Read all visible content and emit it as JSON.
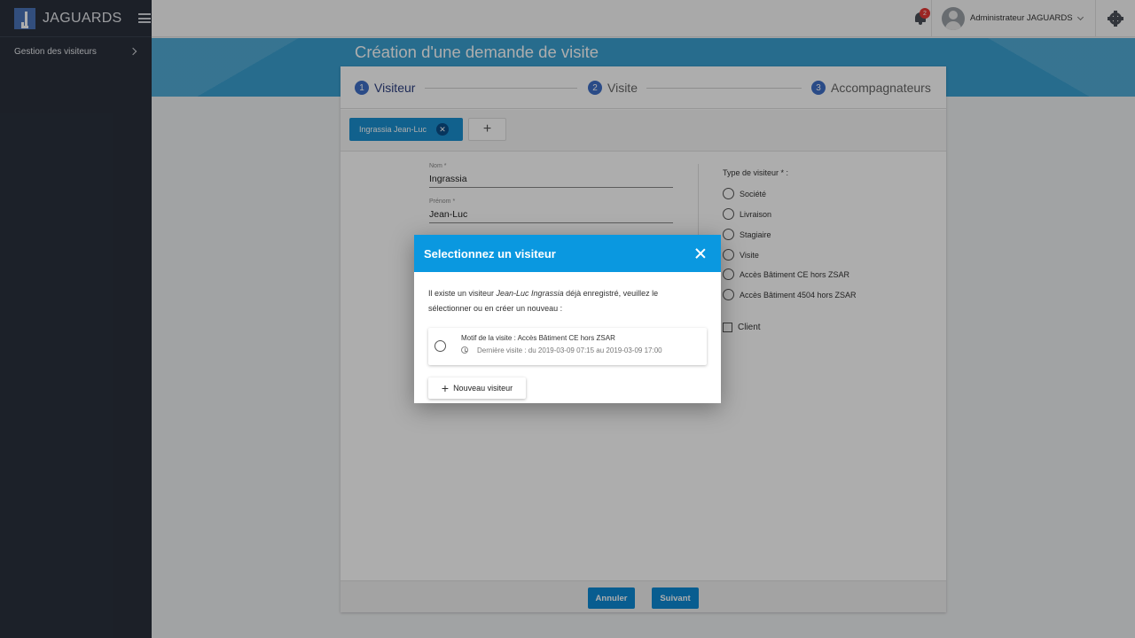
{
  "sidebar": {
    "brand": "JAGUARDS",
    "items": [
      {
        "label": "Gestion des visiteurs"
      }
    ]
  },
  "topbar": {
    "notification_count": "2",
    "user_name": "Administrateur JAGUARDS"
  },
  "page": {
    "title": "Création d'une demande de visite"
  },
  "stepper": {
    "steps": [
      {
        "number": "1",
        "label": "Visiteur",
        "active": true
      },
      {
        "number": "2",
        "label": "Visite",
        "active": false
      },
      {
        "number": "3",
        "label": "Accompagnateurs",
        "active": false
      }
    ]
  },
  "visitor_chips": {
    "items": [
      {
        "label": "Ingrassia Jean-Luc"
      }
    ],
    "add_label": "+"
  },
  "form": {
    "nom_label": "Nom *",
    "nom_value": "Ingrassia",
    "prenom_label": "Prénom *",
    "prenom_value": "Jean-Luc",
    "type_label": "Type de visiteur * :",
    "types": [
      {
        "label": "Société"
      },
      {
        "label": "Livraison"
      },
      {
        "label": "Stagiaire"
      },
      {
        "label": "Visite"
      },
      {
        "label": "Accès Bâtiment CE hors ZSAR"
      },
      {
        "label": "Accès Bâtiment 4504 hors ZSAR"
      }
    ],
    "client_label": "Client"
  },
  "footer": {
    "cancel_label": "Annuler",
    "next_label": "Suivant"
  },
  "modal": {
    "title": "Selectionnez un visiteur",
    "text_before": "Il existe un visiteur ",
    "text_name": "Jean-Luc Ingrassia",
    "text_after": " déjà enregistré, veuillez le sélectionner ou en créer un nouveau :",
    "option_title": "Motif de la visite : Accès Bâtiment CE hors ZSAR",
    "option_sub": "Dernière visite : du 2019-03-09 07:15 au 2019-03-09 17:00",
    "new_button": "Nouveau visiteur"
  },
  "colors": {
    "accent": "#0a98e0",
    "sidebar": "#2a303c",
    "badge": "#e53935"
  }
}
